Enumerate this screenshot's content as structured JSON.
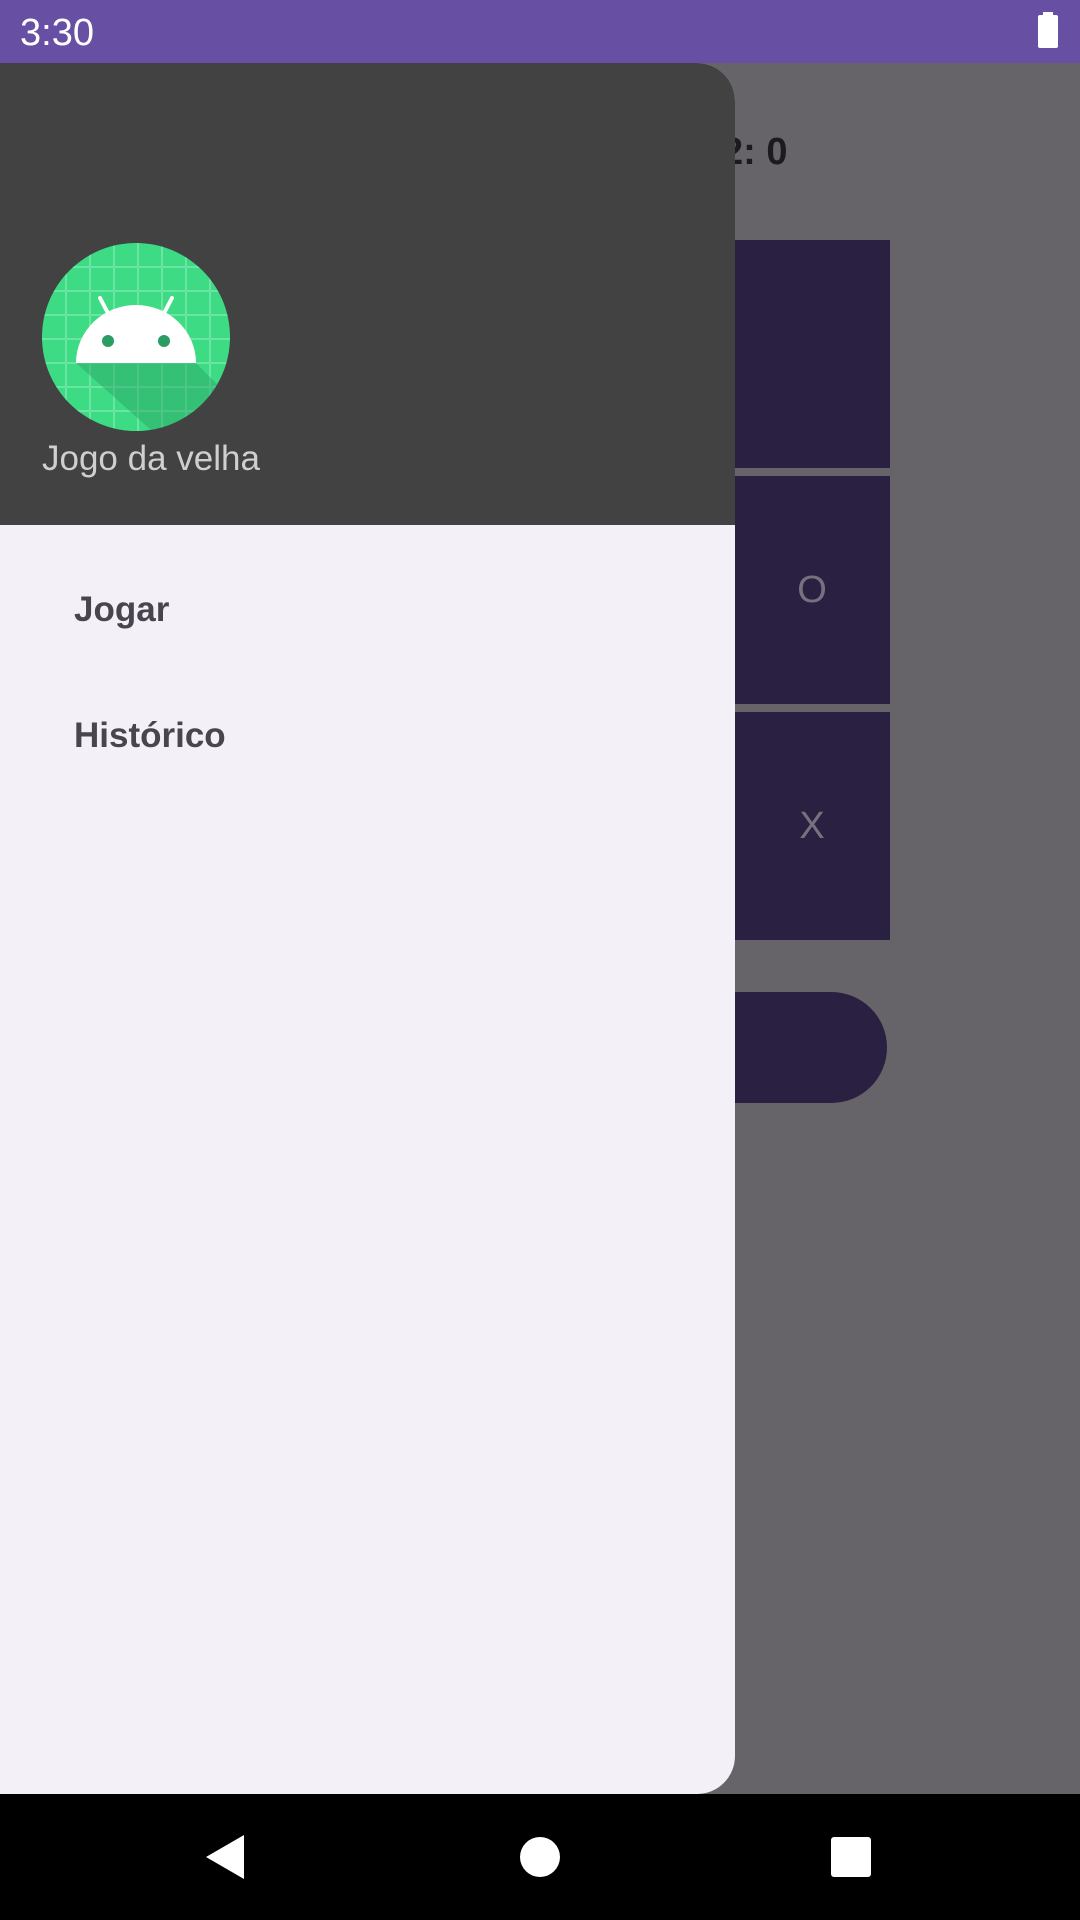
{
  "status_bar": {
    "time": "3:30",
    "battery_icon": "battery-full-icon",
    "background_color": "#6750a4"
  },
  "app": {
    "score_text": "2: 0",
    "cells": [
      {
        "mark": ""
      },
      {
        "mark": "O"
      },
      {
        "mark": "X"
      }
    ],
    "cell_color": "#2a2142"
  },
  "drawer": {
    "header_icon": "android-icon",
    "header_title": "Jogo da velha",
    "header_color": "#424242",
    "menu": [
      {
        "label": "Jogar"
      },
      {
        "label": "Histórico"
      }
    ]
  },
  "nav_bar": {
    "back_icon": "back-triangle-icon",
    "home_icon": "home-circle-icon",
    "recents_icon": "recents-square-icon"
  }
}
